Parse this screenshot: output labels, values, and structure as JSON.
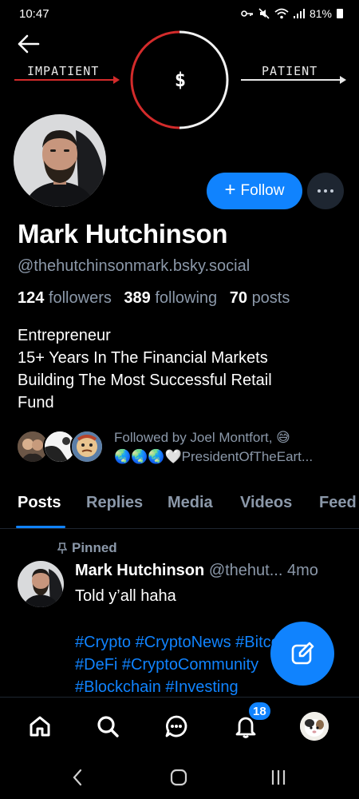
{
  "status_bar": {
    "time": "10:47",
    "battery": "81%",
    "icons": [
      "key-icon",
      "mute-icon",
      "wifi-icon",
      "signal-icon",
      "battery-icon"
    ]
  },
  "banner": {
    "left_label": "IMPATIENT",
    "right_label": "PATIENT",
    "center_symbol": "$",
    "accent_red": "#d32b2b"
  },
  "profile": {
    "display_name": "Mark Hutchinson",
    "handle": "@thehutchinsonmark.bsky.social",
    "followers_count": "124",
    "followers_label": "followers",
    "following_count": "389",
    "following_label": "following",
    "posts_count": "70",
    "posts_label": "posts",
    "bio_lines": [
      "Entrepreneur",
      "15+ Years In The Financial Markets",
      "Building The Most Successful Retail",
      "Fund"
    ],
    "follow_label": "Follow",
    "followed_by_line1": "Followed by Joel Montfort, 😅",
    "followed_by_line2": "🌏🌏🌏🤍PresidentOfTheEart..."
  },
  "tabs": [
    {
      "label": "Posts",
      "active": true
    },
    {
      "label": "Replies",
      "active": false
    },
    {
      "label": "Media",
      "active": false
    },
    {
      "label": "Videos",
      "active": false
    },
    {
      "label": "Feed",
      "active": false
    }
  ],
  "post": {
    "pinned_label": "Pinned",
    "author": "Mark Hutchinson",
    "handle": "@thehut...",
    "time": "4mo",
    "text": "Told y’all haha",
    "hashtag_lines": [
      "#Crypto #CryptoNews #Bitcoins",
      "#DeFi #CryptoCommunity",
      "#Blockchain #Investing"
    ]
  },
  "bottom_nav": {
    "items": [
      "home-icon",
      "search-icon",
      "chat-icon",
      "notifications-icon",
      "profile-avatar"
    ],
    "notifications_badge": "18"
  },
  "colors": {
    "accent": "#1083fe",
    "muted_text": "#8b98a9",
    "background": "#000000"
  }
}
